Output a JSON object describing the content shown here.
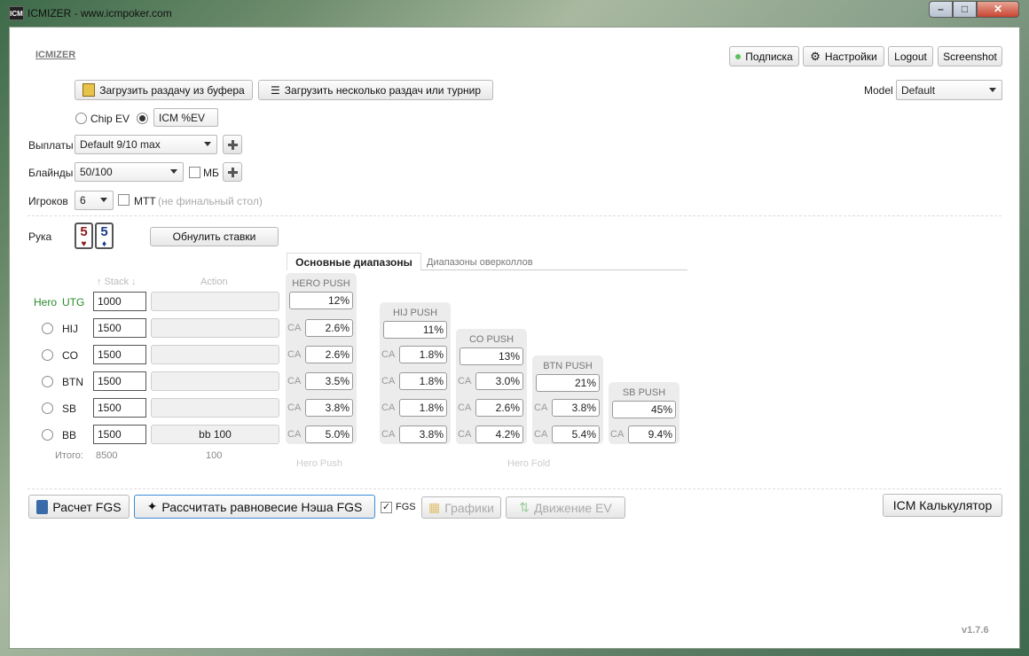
{
  "window": {
    "title": "ICMIZER - www.icmpoker.com",
    "icon": "ICM"
  },
  "header": {
    "brand": "ICMIZER",
    "subscription": "Подписка",
    "settings": "Настройки",
    "logout": "Logout",
    "screenshot": "Screenshot",
    "model_label": "Model",
    "model_value": "Default"
  },
  "loaders": {
    "from_clipboard": "Загрузить раздачу из буфера",
    "multiple": "Загрузить несколько раздач или турнир"
  },
  "ev_mode": {
    "chip_ev": "Chip EV",
    "icm_ev": "ICM %EV"
  },
  "form": {
    "payouts_label": "Выплаты",
    "payouts_value": "Default 9/10 max",
    "blinds_label": "Блайнды",
    "blinds_value": "50/100",
    "mb_label": "МБ",
    "players_label": "Игроков",
    "players_value": "6",
    "mtt_label": "МТТ",
    "mtt_note": "(не финальный стол)"
  },
  "hand": {
    "label": "Рука",
    "card1": "5",
    "suit1": "♥",
    "card2": "5",
    "suit2": "♦",
    "reset": "Обнулить ставки"
  },
  "tabs": {
    "main": "Основные диапазоны",
    "overcalls": "Диапазоны оверколлов"
  },
  "table": {
    "stack_header": "Stack",
    "action_header": "Action",
    "hero_label": "Hero",
    "total_label": "Итого:",
    "total_stack": "8500",
    "total_action": "100",
    "rows": [
      {
        "pos": "UTG",
        "stack": "1000",
        "action": ""
      },
      {
        "pos": "HIJ",
        "stack": "1500",
        "action": ""
      },
      {
        "pos": "CO",
        "stack": "1500",
        "action": ""
      },
      {
        "pos": "BTN",
        "stack": "1500",
        "action": ""
      },
      {
        "pos": "SB",
        "stack": "1500",
        "action": ""
      },
      {
        "pos": "BB",
        "stack": "1500",
        "action": "bb 100"
      }
    ]
  },
  "ranges": {
    "hero_push_title": "HERO PUSH",
    "hero_push": "12%",
    "hero_push_calls": [
      "2.6%",
      "2.6%",
      "3.5%",
      "3.8%",
      "5.0%"
    ],
    "ca": "CA",
    "hij_title": "HIJ PUSH",
    "hij_push": "11%",
    "hij_calls": [
      "1.8%",
      "1.8%",
      "1.8%",
      "3.8%"
    ],
    "co_title": "CO PUSH",
    "co_push": "13%",
    "co_calls": [
      "3.0%",
      "2.6%",
      "4.2%"
    ],
    "btn_title": "BTN PUSH",
    "btn_push": "21%",
    "btn_calls": [
      "3.8%",
      "5.4%"
    ],
    "sb_title": "SB PUSH",
    "sb_push": "45%",
    "sb_calls": [
      "9.4%"
    ],
    "hero_push_caption": "Hero Push",
    "hero_fold_caption": "Hero Fold"
  },
  "bottom": {
    "fgs_calc": "Расчет FGS",
    "nash": "Рассчитать равновесие Нэша FGS",
    "fgs_check": "FGS",
    "charts": "Графики",
    "ev_move": "Движение EV",
    "icm_calc": "ICM Калькулятор"
  },
  "version": "v1.7.6",
  "colors": {
    "push_green": "#1a6a1a",
    "sb_orange": "#f3a85c",
    "online_dot": "#5cc25c"
  }
}
